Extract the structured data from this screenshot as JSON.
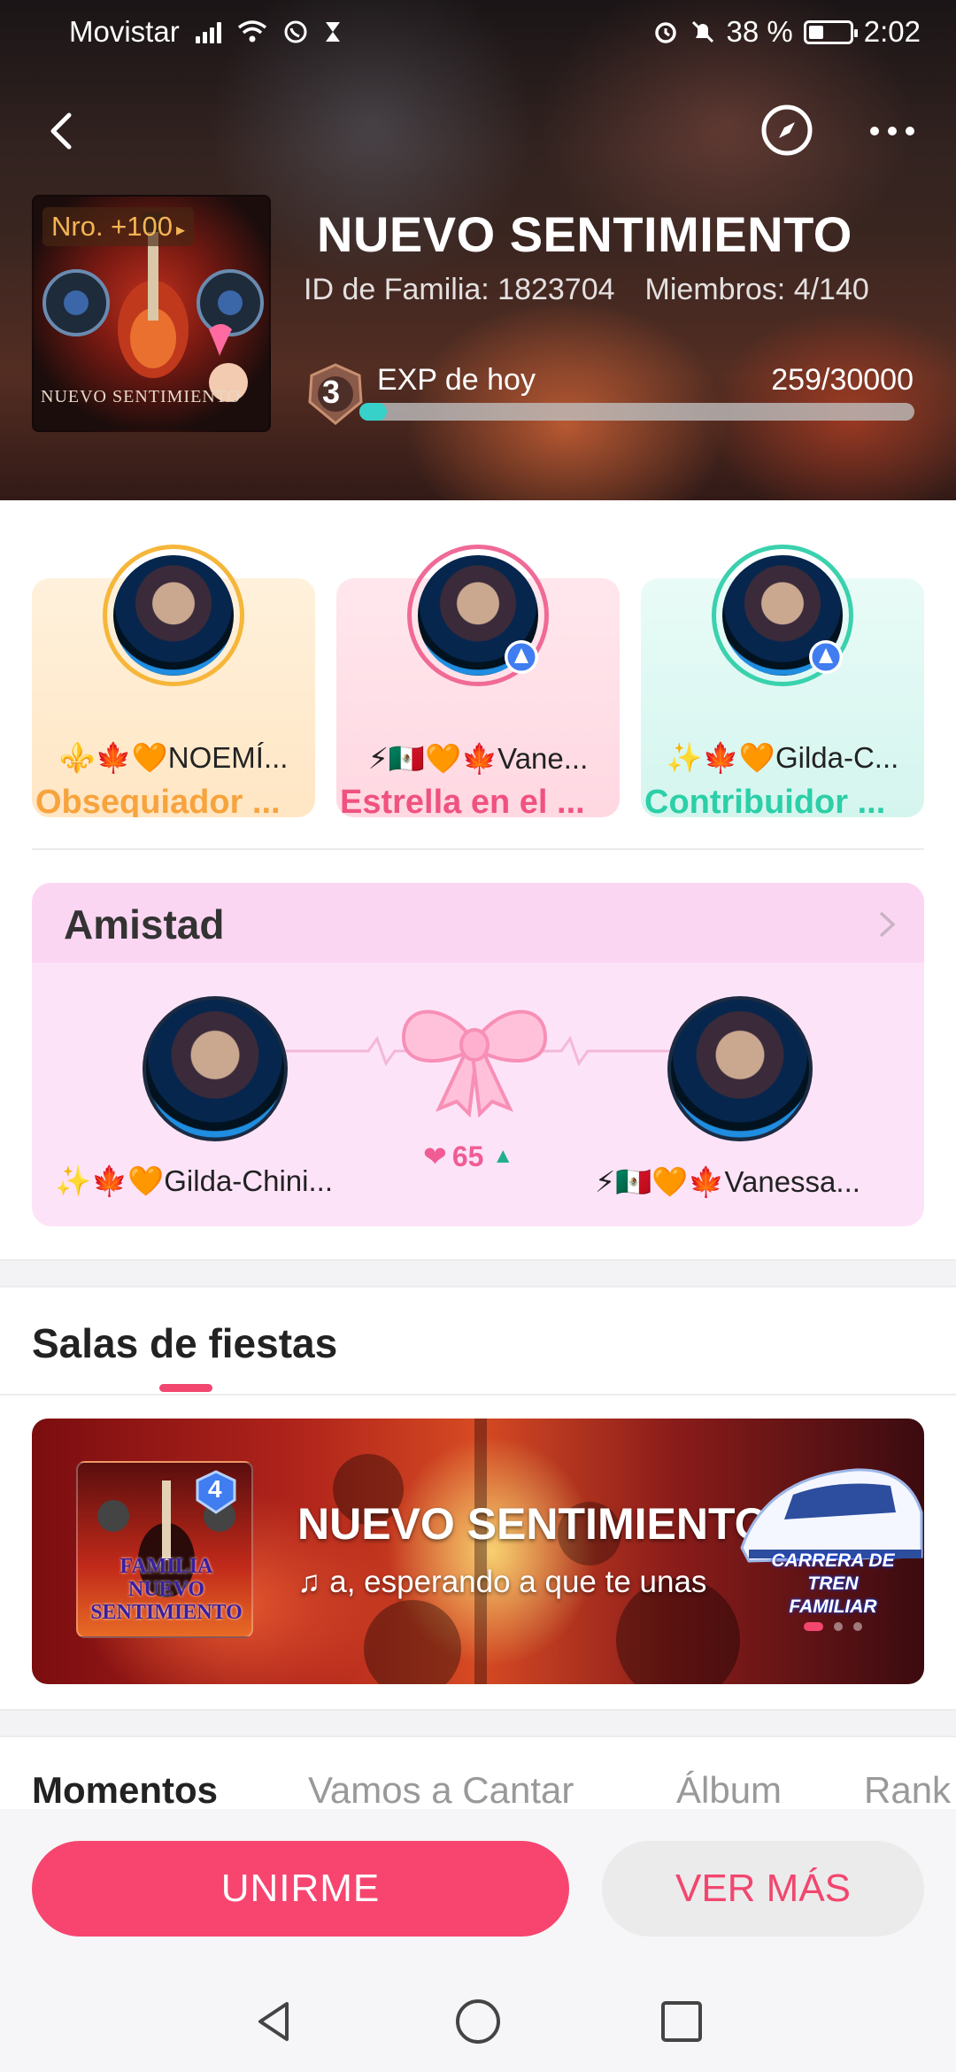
{
  "status_bar": {
    "carrier": "Movistar",
    "battery": "38 %",
    "time": "2:02"
  },
  "header": {
    "family_name": "NUEVO SENTIMIENTO",
    "family_id": "ID de Familia: 1823704",
    "members": "Miembros: 4/140",
    "rank_badge": "Nro. +100",
    "art_caption": "NUEVO SENTIMIENTO",
    "level": "3",
    "exp_label": "EXP de hoy",
    "exp_value": "259/30000",
    "exp_fraction": 0.0086
  },
  "honors": [
    {
      "name": "⚜️🍁🧡NOEMÍ...",
      "title": "Obsequiador ...",
      "color": "#f7a33d",
      "ring": "#f5b63a"
    },
    {
      "name": "⚡🇲🇽🧡🍁Vane...",
      "title": "Estrella en el ...",
      "color": "#f0527f",
      "ring": "#f06a96"
    },
    {
      "name": "✨🍁🧡Gilda-C...",
      "title": "Contribuidor ...",
      "color": "#2ccfa7",
      "ring": "#3ad1ad"
    }
  ],
  "friendship": {
    "title": "Amistad",
    "score": "65",
    "left_name": "✨🍁🧡Gilda-Chini...",
    "right_name": "⚡🇲🇽🧡🍁Vanessa..."
  },
  "party": {
    "section_title": "Salas de fiestas",
    "room_name": "NUEVO SENTIMIENTO",
    "room_subtitle": "a, esperando a que te unas",
    "room_level": "4",
    "thumb_text_1": "FAMILIA",
    "thumb_text_2": "NUEVO",
    "thumb_text_3": "SENTIMIENTO",
    "promo_line_1": "CARRERA DE TREN",
    "promo_line_2": "FAMILIAR"
  },
  "tabs": [
    "Momentos",
    "Vamos a Cantar",
    "Álbum",
    "Rank"
  ],
  "actions": {
    "join": "UNIRME",
    "more": "VER MÁS"
  },
  "colors": {
    "accent": "#f7456f",
    "exp_fill": "#37d1c9"
  }
}
